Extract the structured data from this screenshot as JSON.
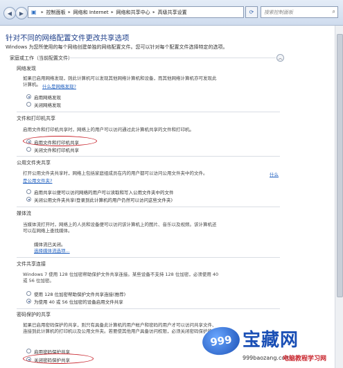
{
  "address_bar": {
    "crumbs": [
      "控制面板",
      "网络和 Internet",
      "网络和共享中心",
      "高级共享设置"
    ],
    "search_placeholder": "搜索控制面板"
  },
  "page": {
    "title": "针对不同的网络配置文件更改共享选项",
    "description": "Windows 为您所使用的每个网络创建单独的网络配置文件。您可以针对每个配置文件选择特定的选项。",
    "profile_header": "家庭或工作（当前配置文件）"
  },
  "sections": {
    "discovery": {
      "title": "网络发现",
      "desc1": "如果已启用网络发现，则此计算机可以发现其他网络计算机和设备，而其他网络计算机亦可发现此",
      "desc2": "计算机。",
      "link": "什么是网络发现?",
      "opt_on": "启用网络发现",
      "opt_off": "关闭网络发现"
    },
    "printer": {
      "title": "文件和打印机共享",
      "desc": "启用文件和打印机共享时，网络上的用户可以访问通过此计算机共享的文件和打印机。",
      "opt_on": "启用文件和打印机共享",
      "opt_off": "关闭文件和打印机共享"
    },
    "public": {
      "title": "公用文件夹共享",
      "desc1": "打开公用文件夹共享时，网络上包括家庭组成员在内的用户都可以访问公用文件夹中的文件。",
      "link1": "什么",
      "link2": "是公用文件夹?",
      "opt_on": "启用共享以便可以访问网络的用户可以读取和写入公用文件夹中的文件",
      "opt_off": "关闭公用文件夹共享(登录到此计算机的用户仍然可以访问这些文件夹)"
    },
    "media": {
      "title": "媒体流",
      "desc1": "当媒体流打开时，网络上的人员和设备便可以访问该计算机上的图片、音乐以及视频。该计算机还",
      "desc2": "可以在网络上查找媒体。",
      "status": "媒体流已关闭。",
      "link": "选择媒体流选项..."
    },
    "connection": {
      "title": "文件共享连接",
      "desc1": "Windows 7 使用 128 位加密帮助保护文件共享连接。某些设备不支持 128 位加密，必须使用 40",
      "desc2": "或 56 位加密。",
      "opt_128": "使用 128 位加密帮助保护文件共享连接(推荐)",
      "opt_40": "为使用 40 或 56 位加密的设备启用文件共享"
    },
    "password": {
      "title": "密码保护的共享",
      "desc1": "如果已启用密码保护的共享，则只有具备此计算机的用户帐户和密码的用户才可以访问共享文件、",
      "desc2": "连接到此计算机的打印机以及公用文件夹。若要使其他用户具备访问权限，必须关闭密码保护的共享。",
      "opt_on": "启用密码保护共享",
      "opt_off": "关闭密码保护共享"
    }
  },
  "watermark": {
    "badge": "999",
    "name": "宝藏网",
    "domain": "999baozang.com",
    "slogan": "电脑教程学习网"
  },
  "colors": {
    "title": "#1e3f8a",
    "link": "#1f5fbf",
    "highlight_oval": "#c8232b"
  }
}
